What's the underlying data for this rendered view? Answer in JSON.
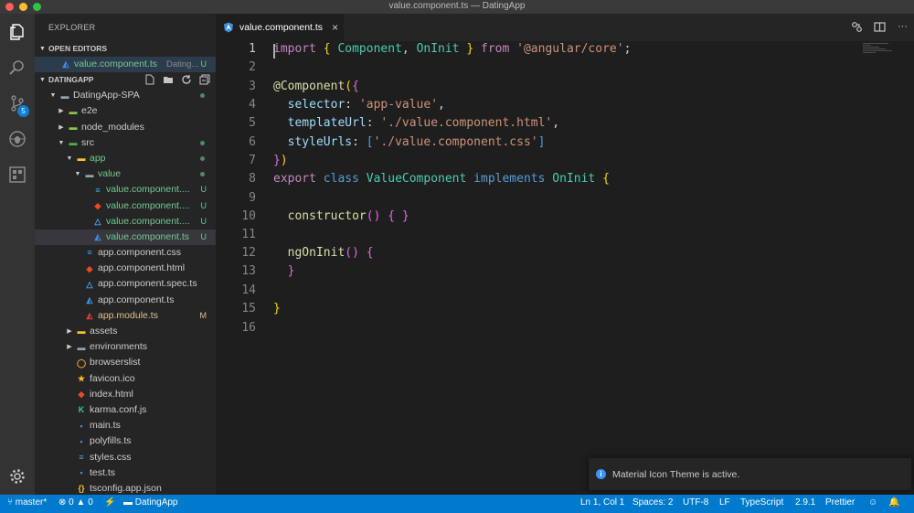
{
  "window": {
    "title": "value.component.ts — DatingApp"
  },
  "activity_bar": {
    "items": [
      "explorer-icon",
      "search-icon",
      "source-control-icon",
      "debug-icon",
      "extensions-icon"
    ],
    "source_control_badge": "5",
    "settings": "gear-icon"
  },
  "sidebar": {
    "title": "EXPLORER",
    "open_editors": {
      "heading": "OPEN EDITORS",
      "file": {
        "name": "value.component.ts",
        "folder": "Dating...",
        "status": "U"
      }
    },
    "workspace": {
      "heading": "DATINGAPP",
      "tree": [
        {
          "name": "DatingApp-SPA",
          "kind": "folder-open",
          "status": "dot"
        },
        {
          "name": "e2e",
          "kind": "folder",
          "status": ""
        },
        {
          "name": "node_modules",
          "kind": "folder",
          "status": ""
        },
        {
          "name": "src",
          "kind": "folder-open",
          "status": "dot"
        },
        {
          "name": "app",
          "kind": "folder-open",
          "status": "dot"
        },
        {
          "name": "value",
          "kind": "folder-open",
          "status": "dot"
        },
        {
          "name": "value.component....",
          "kind": "css",
          "status": "U"
        },
        {
          "name": "value.component....",
          "kind": "html",
          "status": "U"
        },
        {
          "name": "value.component....",
          "kind": "spec",
          "status": "U"
        },
        {
          "name": "value.component.ts",
          "kind": "angular",
          "status": "U"
        },
        {
          "name": "app.component.css",
          "kind": "css",
          "status": ""
        },
        {
          "name": "app.component.html",
          "kind": "html",
          "status": ""
        },
        {
          "name": "app.component.spec.ts",
          "kind": "spec",
          "status": ""
        },
        {
          "name": "app.component.ts",
          "kind": "angular",
          "status": ""
        },
        {
          "name": "app.module.ts",
          "kind": "angular-red",
          "status": "M"
        },
        {
          "name": "assets",
          "kind": "folder",
          "status": ""
        },
        {
          "name": "environments",
          "kind": "folder",
          "status": ""
        },
        {
          "name": "browserslist",
          "kind": "browserslist",
          "status": ""
        },
        {
          "name": "favicon.ico",
          "kind": "star",
          "status": ""
        },
        {
          "name": "index.html",
          "kind": "html",
          "status": ""
        },
        {
          "name": "karma.conf.js",
          "kind": "karma",
          "status": ""
        },
        {
          "name": "main.ts",
          "kind": "ts",
          "status": ""
        },
        {
          "name": "polyfills.ts",
          "kind": "ts",
          "status": ""
        },
        {
          "name": "styles.css",
          "kind": "css",
          "status": ""
        },
        {
          "name": "test.ts",
          "kind": "ts",
          "status": ""
        },
        {
          "name": "tsconfig.app.json",
          "kind": "json",
          "status": ""
        }
      ]
    }
  },
  "tab": {
    "label": "value.component.ts",
    "close": "×"
  },
  "editor": {
    "line_numbers": [
      "1",
      "2",
      "3",
      "4",
      "5",
      "6",
      "7",
      "8",
      "9",
      "10",
      "11",
      "12",
      "13",
      "14",
      "15",
      "16"
    ]
  },
  "notification": {
    "text": "Material Icon Theme is active."
  },
  "statusbar": {
    "branch": "master*",
    "errors": "0",
    "warnings": "0",
    "folder": "DatingApp",
    "position": "Ln 1, Col 1",
    "spaces": "Spaces: 2",
    "encoding": "UTF-8",
    "eol": "LF",
    "language": "TypeScript",
    "version": "2.9.1",
    "formatter": "Prettier"
  },
  "colors": {
    "statusbar": "#007acc",
    "sidebar": "#252526",
    "editor": "#1e1e1e",
    "activitybar": "#333333",
    "untracked": "#73c991",
    "modified": "#e2c08d"
  }
}
